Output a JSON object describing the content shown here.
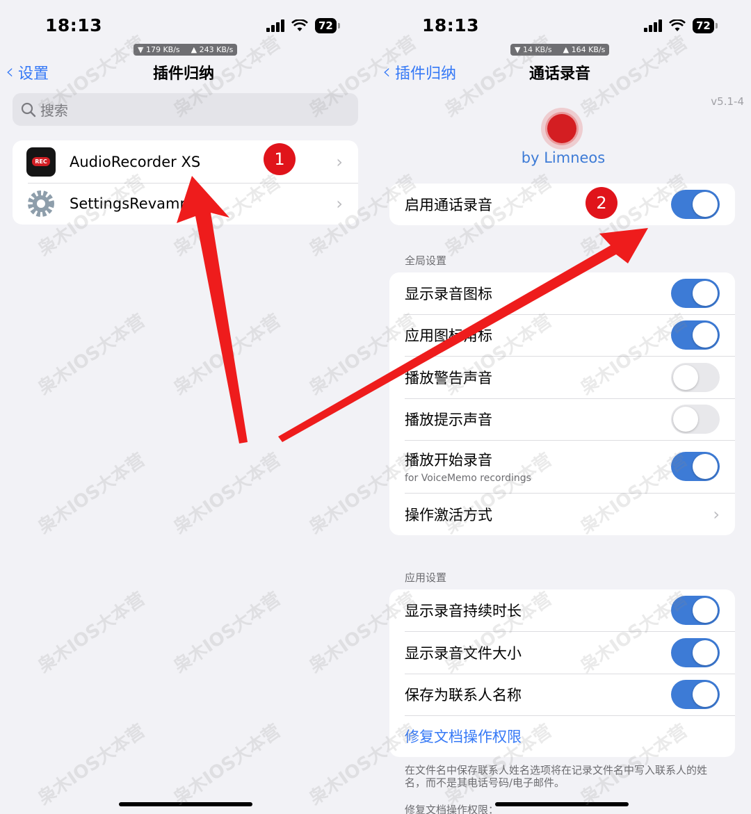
{
  "left": {
    "status": {
      "time": "18:13",
      "battery": "72"
    },
    "network": {
      "down": "▼ 179 KB/s",
      "up": "▲ 243 KB/s"
    },
    "nav": {
      "back_label": "设置",
      "title": "插件归纳"
    },
    "search": {
      "placeholder": "搜索"
    },
    "items": [
      {
        "label": "AudioRecorder XS",
        "icon": "rec-app-icon",
        "icon_text": "REC"
      },
      {
        "label": "SettingsRevamp",
        "icon": "gear-icon"
      }
    ],
    "badge": "1"
  },
  "right": {
    "status": {
      "time": "18:13",
      "battery": "72"
    },
    "network": {
      "down": "▼ 14 KB/s",
      "up": "▲ 164 KB/s"
    },
    "nav": {
      "back_label": "插件归纳",
      "title": "通话录音"
    },
    "version": "v5.1-4",
    "author": "by Limneos",
    "enable": {
      "label": "启用通话录音",
      "on": true
    },
    "badge": "2",
    "global_header": "全局设置",
    "global_items": [
      {
        "label": "显示录音图标",
        "on": true
      },
      {
        "label": "应用图标角标",
        "on": true
      },
      {
        "label": "播放警告声音",
        "on": false
      },
      {
        "label": "播放提示声音",
        "on": false
      },
      {
        "label": "播放开始录音",
        "sublabel": "for VoiceMemo recordings",
        "on": true
      }
    ],
    "activation": {
      "label": "操作激活方式"
    },
    "app_header": "应用设置",
    "app_items": [
      {
        "label": "显示录音持续时长",
        "on": true
      },
      {
        "label": "显示录音文件大小",
        "on": true
      },
      {
        "label": "保存为联系人名称",
        "on": true
      }
    ],
    "fix_link": "修复文档操作权限",
    "footer_note": "在文件名中保存联系人姓名选项将在记录文件名中写入联系人的姓名，而不是其电话号码/电子邮件。",
    "footer_note2": "修复文档操作权限："
  },
  "watermark": "枭木IOS大本营",
  "colors": {
    "accent": "#3478f6",
    "toggle_on": "#3d7bd6",
    "badge": "#e0141b",
    "arrow": "#ee1c1c"
  }
}
